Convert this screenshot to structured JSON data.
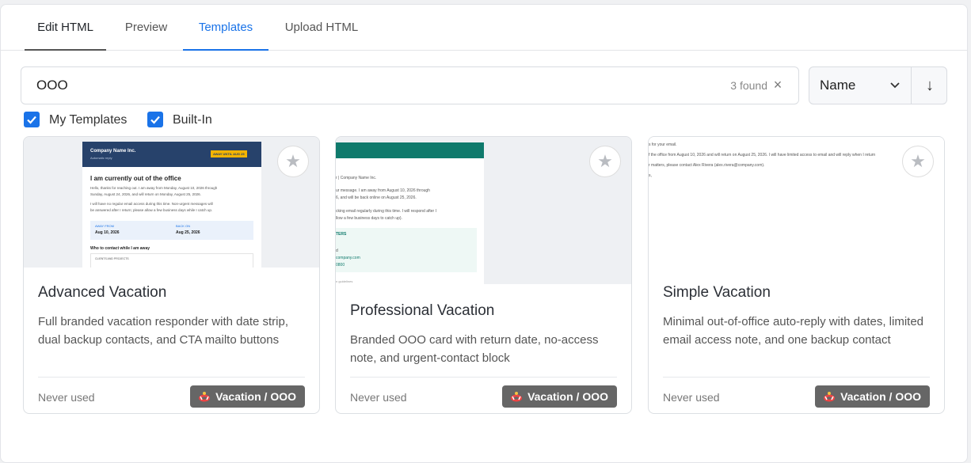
{
  "tabs": [
    {
      "label": "Edit HTML"
    },
    {
      "label": "Preview"
    },
    {
      "label": "Templates"
    },
    {
      "label": "Upload HTML"
    }
  ],
  "search": {
    "value": "OOO",
    "found": "3 found",
    "clear": "×"
  },
  "sort": {
    "field": "Name",
    "direction": "↓"
  },
  "filters": [
    {
      "label": "My Templates",
      "checked": true
    },
    {
      "label": "Built-In",
      "checked": true
    }
  ],
  "cards": [
    {
      "title": "Advanced Vacation",
      "description": "Full branded vacation responder with date strip, dual backup contacts, and CTA mailto buttons",
      "usage": "Never used",
      "tag": "Vacation / OOO",
      "preview": {
        "company": "Company Name Inc.",
        "subtitle": "Automatic reply",
        "badge": "AWAY UNTIL AUG 25",
        "heading": "I am currently out of the office",
        "body1": "Hello, thanks for reaching out. I am away from Monday, August 10, 2026 through",
        "body2": "Sunday, August 24, 2026, and will return on Monday, August 25, 2026.",
        "body3": "I will have no regular email access during this time. Non-urgent messages will",
        "body4": "be answered after I return; please allow a few business days while I catch up.",
        "away_label": "AWAY FROM",
        "away_date": "Aug 10, 2026",
        "back_label": "BACK ON",
        "back_date": "Aug 25, 2026",
        "contact_heading": "Who to contact while I am away",
        "contact_sub": "CLIENTS AND PROJECTS"
      }
    },
    {
      "title": "Professional Vacation",
      "description": "Branded OOO card with return date, no-access note, and urgent-contact block",
      "usage": "Never used",
      "tag": "Vacation / OOO",
      "preview": {
        "line1": "r | Company Name Inc.",
        "line2": "ur message. I am away from August 10, 2026 through",
        "line3": "6, and will be back online on August 25, 2026.",
        "line4": "cking email regularly during this time. I will respond after I",
        "line5": "llow a few business days to catch up).",
        "block1": "TERS",
        "block2": "d",
        "block3": "company.com",
        "block4": "0800",
        "footer": "n guidelines"
      }
    },
    {
      "title": "Simple Vacation",
      "description": "Minimal out-of-office auto-reply with dates, limited email access note, and one backup contact",
      "usage": "Never used",
      "tag": "Vacation / OOO",
      "preview": {
        "line1": "s for your email.",
        "line2": "f the office from August 10, 2026 and will return on August 25, 2026. I will have limited access to email and will reply when I return",
        "line3": "r matters, please contact Alex Rivera (alex.rivera@company.com).",
        "line4": "s,"
      }
    }
  ],
  "colors": {
    "accent": "#1a73e8",
    "tag_bg": "#666666",
    "header_navy": "#27426b",
    "header_teal": "#0f7a6c"
  }
}
